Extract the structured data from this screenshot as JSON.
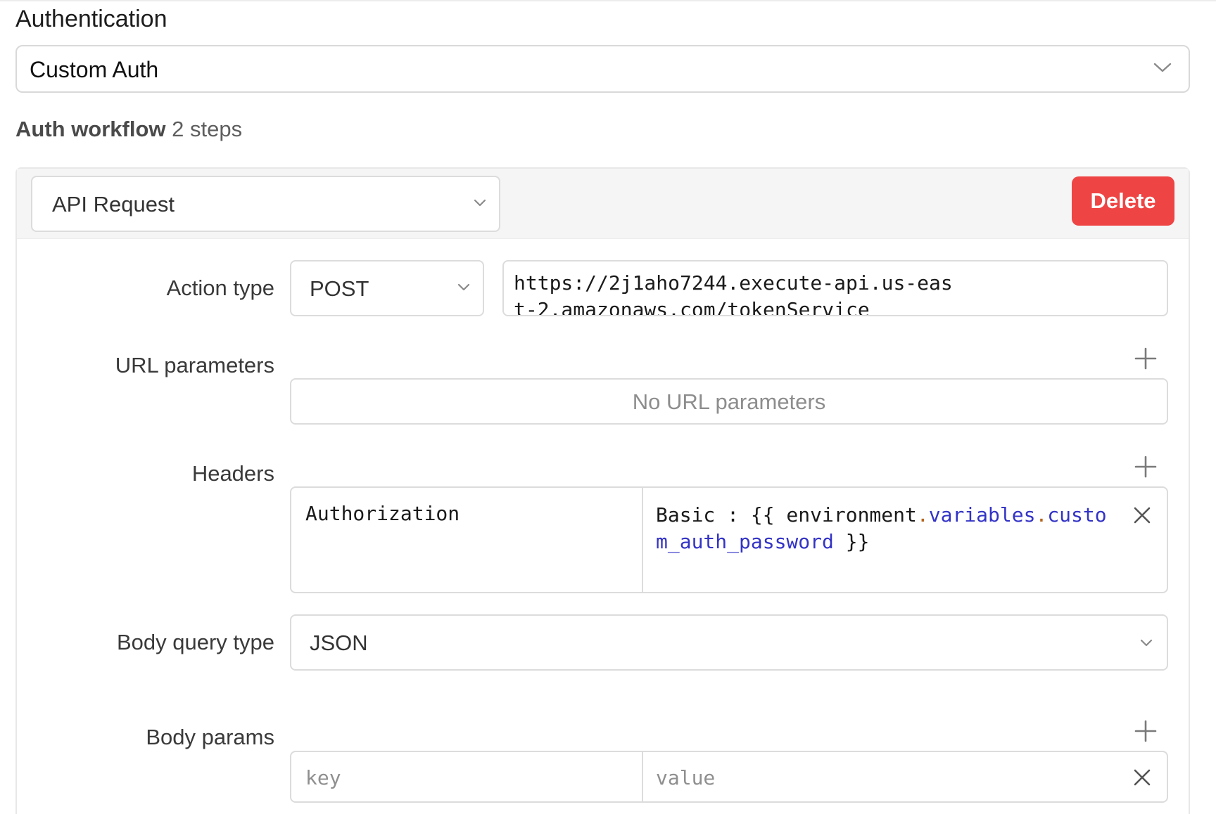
{
  "authentication": {
    "title": "Authentication",
    "selected": "Custom Auth"
  },
  "workflow": {
    "label": "Auth workflow",
    "count": "2 steps"
  },
  "step": {
    "type": "API Request",
    "delete_label": "Delete",
    "action_type_label": "Action type",
    "method": "POST",
    "url": "https://2j1aho7244.execute-api.us-east-2.amazonaws.com/tokenService",
    "url_params_label": "URL parameters",
    "url_params_empty": "No URL parameters",
    "headers_label": "Headers",
    "headers": [
      {
        "key": "Authorization",
        "value_prefix": "Basic : {{ environment",
        "dot1": ".",
        "prop1": "variables",
        "dot2": ".",
        "prop2": "custom_auth_password",
        "value_suffix": " }}"
      }
    ],
    "body_type_label": "Body query type",
    "body_type": "JSON",
    "body_params_label": "Body params",
    "body_params_key_placeholder": "key",
    "body_params_value_placeholder": "value"
  },
  "icons": {
    "dropdown": "chevron-down-icon",
    "add": "plus-icon",
    "remove": "close-icon"
  },
  "colors": {
    "danger": "#ef4444",
    "code_property": "#3333c6",
    "code_punctuation": "#b5651d"
  }
}
